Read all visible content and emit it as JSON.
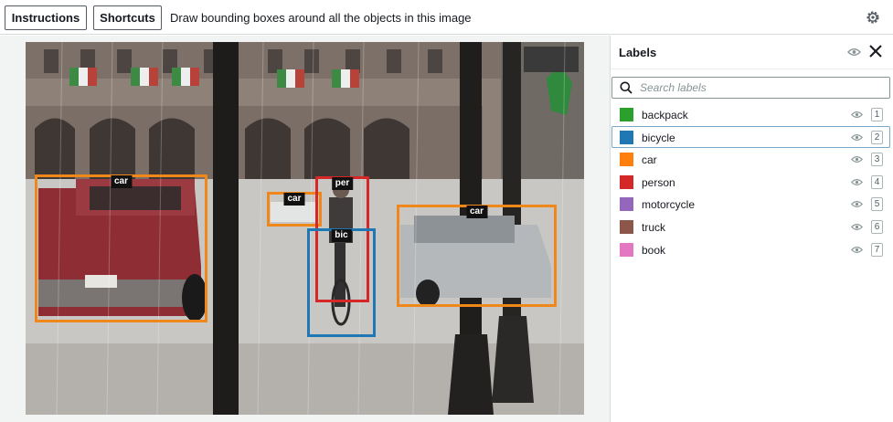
{
  "toolbar": {
    "instructions_label": "Instructions",
    "shortcuts_label": "Shortcuts",
    "task_title": "Draw bounding boxes around all the objects in this image",
    "settings_icon": "gear-icon"
  },
  "canvas": {
    "annotations": [
      {
        "tag": "car",
        "color": "#f0871b"
      },
      {
        "tag": "car",
        "color": "#f0871b"
      },
      {
        "tag": "per",
        "color": "#d62728"
      },
      {
        "tag": "bic",
        "color": "#1f77b4"
      },
      {
        "tag": "car",
        "color": "#f0871b"
      }
    ]
  },
  "panel": {
    "title": "Labels",
    "visibility_icon": "eye-icon",
    "close_icon": "close-icon",
    "search_placeholder": "Search labels",
    "search_value": "",
    "selected_index": 1,
    "labels": [
      {
        "name": "backpack",
        "color": "#2ca02c",
        "hotkey": "1"
      },
      {
        "name": "bicycle",
        "color": "#1f77b4",
        "hotkey": "2"
      },
      {
        "name": "car",
        "color": "#ff7f0e",
        "hotkey": "3"
      },
      {
        "name": "person",
        "color": "#d62728",
        "hotkey": "4"
      },
      {
        "name": "motorcycle",
        "color": "#9467bd",
        "hotkey": "5"
      },
      {
        "name": "truck",
        "color": "#8c564b",
        "hotkey": "6"
      },
      {
        "name": "book",
        "color": "#e377c2",
        "hotkey": "7"
      }
    ]
  }
}
